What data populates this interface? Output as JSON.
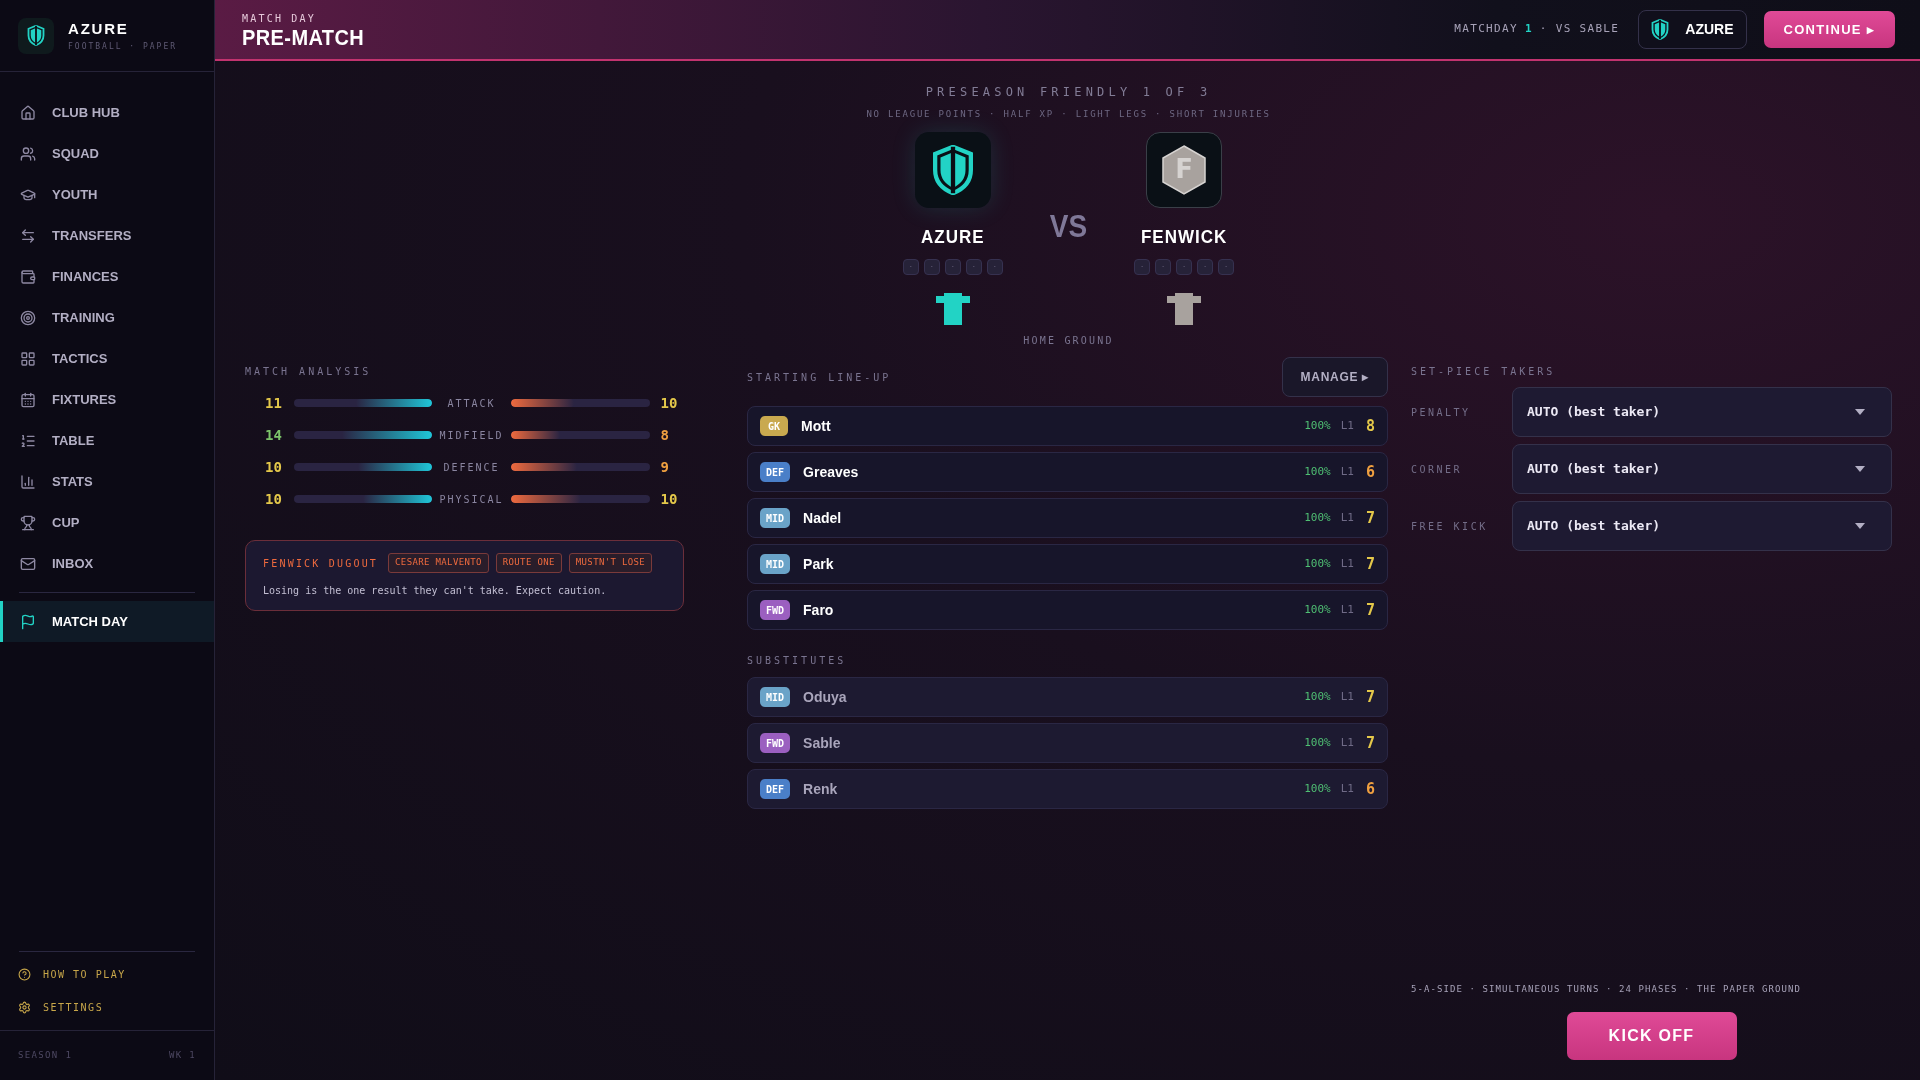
{
  "brand": {
    "name": "AZURE",
    "tagline": "FOOTBALL · PAPER"
  },
  "nav": [
    {
      "label": "CLUB HUB",
      "selected": false
    },
    {
      "label": "SQUAD",
      "selected": false
    },
    {
      "label": "YOUTH",
      "selected": false
    },
    {
      "label": "TRANSFERS",
      "selected": false
    },
    {
      "label": "FINANCES",
      "selected": false
    },
    {
      "label": "TRAINING",
      "selected": false
    },
    {
      "label": "TACTICS",
      "selected": false
    },
    {
      "label": "FIXTURES",
      "selected": false
    },
    {
      "label": "TABLE",
      "selected": false
    },
    {
      "label": "STATS",
      "selected": false
    },
    {
      "label": "CUP",
      "selected": false
    },
    {
      "label": "INBOX",
      "selected": false
    },
    {
      "label": "MATCH DAY",
      "selected": true
    }
  ],
  "sidebar_footer": {
    "links": [
      {
        "label": "HOW TO PLAY"
      },
      {
        "label": "SETTINGS"
      }
    ],
    "season": "SEASON 1",
    "week": "WK 1"
  },
  "header": {
    "eyebrow": "MATCH DAY",
    "title": "PRE-MATCH",
    "matchday_label": "MATCHDAY",
    "matchday_number": "1",
    "opponent": "· VS SABLE",
    "club": "AZURE",
    "continue": "CONTINUE ▸"
  },
  "fixture": {
    "title": "PRESEASON FRIENDLY 1 OF 3",
    "rules": "NO LEAGUE POINTS · HALF XP · LIGHT LEGS · SHORT INJURIES",
    "vs": "VS",
    "venue": "HOME GROUND",
    "teams": [
      {
        "name": "AZURE",
        "kind": "shield",
        "color": "#22d3c5",
        "form": [
          "·",
          "·",
          "·",
          "·",
          "·"
        ]
      },
      {
        "name": "FENWICK",
        "kind": "letter",
        "letter": "F",
        "color": "#a8a29e",
        "form": [
          "·",
          "·",
          "·",
          "·",
          "·"
        ]
      }
    ]
  },
  "analysis": {
    "title": "MATCH ANALYSIS",
    "rows": [
      {
        "label": "ATTACK",
        "home": {
          "value": "11",
          "color": "#e4c84a",
          "level": 0.55
        },
        "away": {
          "value": "10",
          "color": "#e4c84a",
          "level": 0.45
        }
      },
      {
        "label": "MIDFIELD",
        "home": {
          "value": "14",
          "color": "#7cc46a",
          "level": 0.65
        },
        "away": {
          "value": "8",
          "color": "#f0a040",
          "level": 0.35
        }
      },
      {
        "label": "DEFENCE",
        "home": {
          "value": "10",
          "color": "#e4c84a",
          "level": 0.53
        },
        "away": {
          "value": "9",
          "color": "#f0a040",
          "level": 0.47
        }
      },
      {
        "label": "PHYSICAL",
        "home": {
          "value": "10",
          "color": "#e4c84a",
          "level": 0.5
        },
        "away": {
          "value": "10",
          "color": "#e4c84a",
          "level": 0.5
        }
      }
    ],
    "dugout": {
      "title": "FENWICK DUGOUT",
      "tags": [
        "CESARE MALVENTO",
        "ROUTE ONE",
        "MUSTN'T LOSE"
      ],
      "note": "Losing is the one result they can't take. Expect caution."
    }
  },
  "lineup": {
    "title": "STARTING LINE-UP",
    "manage": "MANAGE ▸",
    "subs_title": "SUBSTITUTES",
    "starters": [
      {
        "pos": {
          "text": "GK",
          "color": "#c9a94f"
        },
        "name": "Mott",
        "fitness": "100%",
        "level_tag": "L1",
        "rating": {
          "value": "8",
          "color": "#e4c84a"
        }
      },
      {
        "pos": {
          "text": "DEF",
          "color": "#4a7fc8"
        },
        "name": "Greaves",
        "fitness": "100%",
        "level_tag": "L1",
        "rating": {
          "value": "6",
          "color": "#f0a040"
        }
      },
      {
        "pos": {
          "text": "MID",
          "color": "#6aa3c8"
        },
        "name": "Nadel",
        "fitness": "100%",
        "level_tag": "L1",
        "rating": {
          "value": "7",
          "color": "#e4c84a"
        }
      },
      {
        "pos": {
          "text": "MID",
          "color": "#6aa3c8"
        },
        "name": "Park",
        "fitness": "100%",
        "level_tag": "L1",
        "rating": {
          "value": "7",
          "color": "#e4c84a"
        }
      },
      {
        "pos": {
          "text": "FWD",
          "color": "#9b5fc0"
        },
        "name": "Faro",
        "fitness": "100%",
        "level_tag": "L1",
        "rating": {
          "value": "7",
          "color": "#e4c84a"
        }
      }
    ],
    "subs": [
      {
        "pos": {
          "text": "MID",
          "color": "#6aa3c8"
        },
        "name": "Oduya",
        "fitness": "100%",
        "level_tag": "L1",
        "rating": {
          "value": "7",
          "color": "#e4c84a"
        }
      },
      {
        "pos": {
          "text": "FWD",
          "color": "#9b5fc0"
        },
        "name": "Sable",
        "fitness": "100%",
        "level_tag": "L1",
        "rating": {
          "value": "7",
          "color": "#e4c84a"
        }
      },
      {
        "pos": {
          "text": "DEF",
          "color": "#4a7fc8"
        },
        "name": "Renk",
        "fitness": "100%",
        "level_tag": "L1",
        "rating": {
          "value": "6",
          "color": "#f0a040"
        }
      }
    ]
  },
  "set_pieces": {
    "title": "SET-PIECE TAKERS",
    "rows": [
      {
        "label": "PENALTY",
        "value": "AUTO (best taker)"
      },
      {
        "label": "CORNER",
        "value": "AUTO (best taker)"
      },
      {
        "label": "FREE KICK",
        "value": "AUTO (best taker)"
      }
    ]
  },
  "footer": {
    "note": "5-A-SIDE · SIMULTANEOUS TURNS · 24 PHASES · THE PAPER GROUND",
    "kickoff": "KICK OFF"
  }
}
